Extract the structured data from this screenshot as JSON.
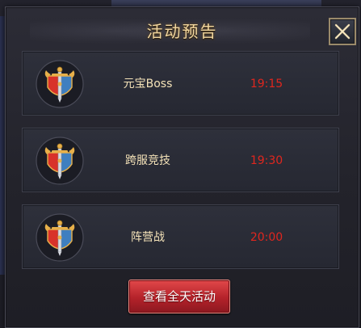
{
  "panel": {
    "title": "活动预告"
  },
  "close_button": {
    "icon": "close-icon"
  },
  "events": [
    {
      "name": "元宝Boss",
      "time": "19:15",
      "icon": "sword-shield-emblem-icon"
    },
    {
      "name": "跨服竞技",
      "time": "19:30",
      "icon": "sword-shield-emblem-icon"
    },
    {
      "name": "阵营战",
      "time": "20:00",
      "icon": "sword-shield-emblem-icon"
    }
  ],
  "footer": {
    "view_all_label": "查看全天活动"
  },
  "colors": {
    "title": "#f2d7a0",
    "event_name": "#f4e2b8",
    "event_time": "#e0261e",
    "button": "#b4222a"
  }
}
